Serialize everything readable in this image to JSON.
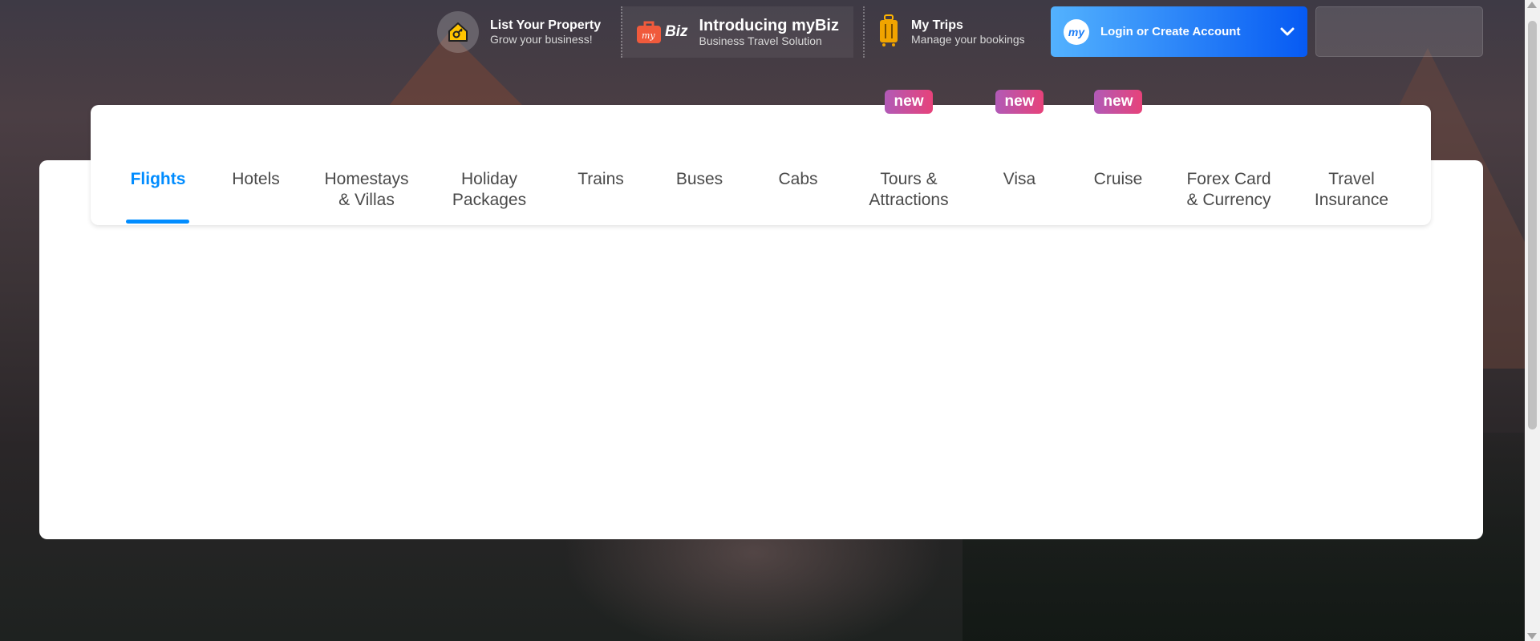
{
  "topbar": {
    "list_property": {
      "title": "List Your Property",
      "subtitle": "Grow your business!",
      "icon": "house-key-icon"
    },
    "mybiz": {
      "logo_text": "Biz",
      "logo_script": "my",
      "title": "Introducing myBiz",
      "subtitle": "Business Travel Solution",
      "icon": "briefcase-icon"
    },
    "my_trips": {
      "title": "My Trips",
      "subtitle": "Manage your bookings",
      "icon": "suitcase-icon"
    },
    "login": {
      "avatar_text": "my",
      "label": "Login or Create Account",
      "icon": "chevron-down-icon"
    }
  },
  "nav": {
    "items": [
      {
        "label": "Flights",
        "active": true
      },
      {
        "label": "Hotels"
      },
      {
        "label": "Homestays\n& Villas"
      },
      {
        "label": "Holiday\nPackages"
      },
      {
        "label": "Trains"
      },
      {
        "label": "Buses"
      },
      {
        "label": "Cabs"
      },
      {
        "label": "Tours &\nAttractions",
        "badge": "new"
      },
      {
        "label": "Visa",
        "badge": "new"
      },
      {
        "label": "Cruise",
        "badge": "new"
      },
      {
        "label": "Forex Card\n& Currency"
      },
      {
        "label": "Travel\nInsurance"
      }
    ]
  },
  "colors": {
    "accent": "#008cff",
    "login_gradient_start": "#53b2fe",
    "login_gradient_end": "#065af3",
    "badge_start": "#b15ab7",
    "badge_end": "#e7427a"
  }
}
